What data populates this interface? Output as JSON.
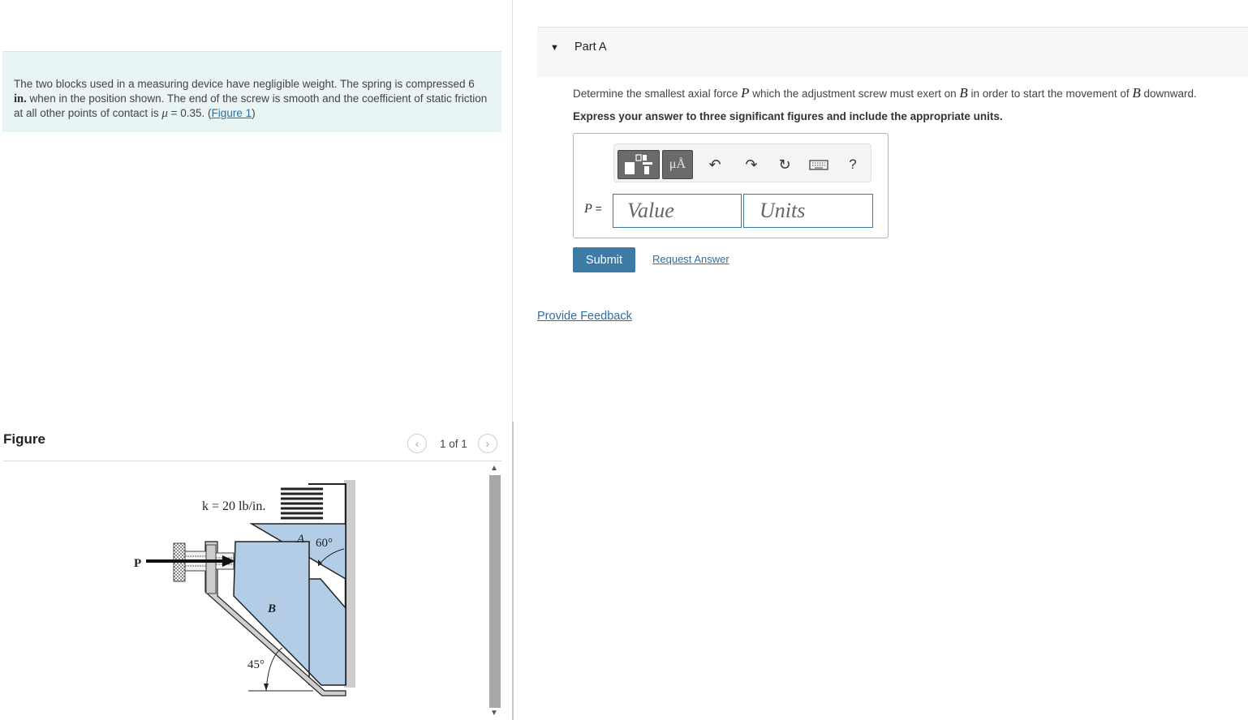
{
  "problem": {
    "text_before_unit": "The two blocks used in a measuring device have negligible weight. The spring is compressed 6 ",
    "unit": "in.",
    "text_after_unit": " when in the position shown. The end of the screw is smooth and the coefficient of static friction at all other points of contact is ",
    "mu_symbol": "μ",
    "mu_value": " = 0.35. (",
    "figure_link": "Figure 1",
    "close_paren": ")"
  },
  "figure": {
    "heading": "Figure",
    "page_count": "1 of 1",
    "prev_icon": "chevron-left-icon",
    "next_icon": "chevron-right-icon",
    "labels": {
      "spring": "k = 20 lb/in.",
      "force": "P",
      "block_a": "A",
      "block_b": "B",
      "angle_top": "60°",
      "angle_bottom": "45°"
    },
    "colors": {
      "block_fill": "#b3cde6",
      "wall_fill": "#c9c9c9"
    }
  },
  "part": {
    "title": "Part A",
    "question_1": "Determine the smallest axial force ",
    "var_p": "P",
    "question_2": " which the adjustment screw must exert on ",
    "var_b1": "B",
    "question_3": " in order to start the movement of ",
    "var_b2": "B",
    "question_4": " downward.",
    "instruction": "Express your answer to three significant figures and include the appropriate units."
  },
  "answer": {
    "label_var": "P",
    "label_eq": " =",
    "value_placeholder": "Value",
    "units_placeholder": "Units",
    "units_button": "μÅ",
    "toolbar_icons": [
      "templates-icon",
      "units-icon",
      "undo-icon",
      "redo-icon",
      "reset-icon",
      "keyboard-icon",
      "help-icon"
    ],
    "help_glyph": "?"
  },
  "actions": {
    "submit": "Submit",
    "request_answer": "Request Answer",
    "provide_feedback": "Provide Feedback"
  }
}
